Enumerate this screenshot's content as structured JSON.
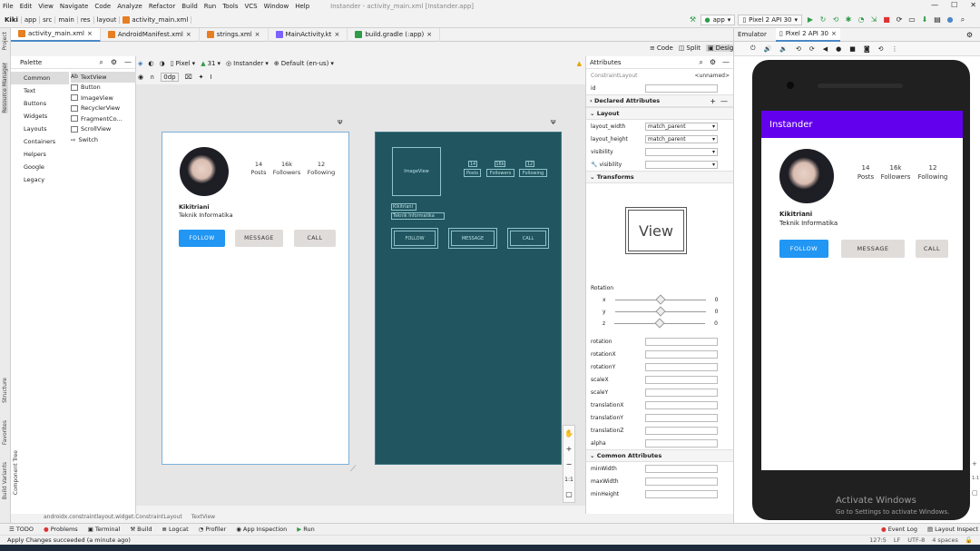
{
  "menubar": {
    "items": [
      "File",
      "Edit",
      "View",
      "Navigate",
      "Code",
      "Analyze",
      "Refactor",
      "Build",
      "Run",
      "Tools",
      "VCS",
      "Window",
      "Help"
    ],
    "title": "Instander - activity_main.xml [Instander.app]"
  },
  "navbar": {
    "crumbs": [
      "Kiki",
      "app",
      "src",
      "main",
      "res",
      "layout"
    ],
    "file": "activity_main.xml",
    "run_config": "app",
    "device": "Pixel 2 API 30"
  },
  "tabs": [
    "activity_main.xml",
    "AndroidManifest.xml",
    "strings.xml",
    "MainActivity.kt",
    "build.gradle (:app)"
  ],
  "tab_colors": [
    "#e67e22",
    "#e67e22",
    "#e67e22",
    "#7b61ff",
    "#2e9b48"
  ],
  "view_modes": {
    "code": "Code",
    "split": "Split",
    "design": "Design"
  },
  "left_strip": {
    "project": "Project",
    "resource_manager": "Resource Manager",
    "structure": "Structure",
    "favorites": "Favorites",
    "build_variants": "Build Variants",
    "component_tree": "Component Tree"
  },
  "palette": {
    "title": "Palette",
    "categories": [
      "Common",
      "Text",
      "Buttons",
      "Widgets",
      "Layouts",
      "Containers",
      "Helpers",
      "Google",
      "Legacy"
    ],
    "items": [
      {
        "label": "TextView",
        "icon": "Ab"
      },
      {
        "label": "Button",
        "icon": ""
      },
      {
        "label": "ImageView",
        "icon": ""
      },
      {
        "label": "RecyclerView",
        "icon": ""
      },
      {
        "label": "FragmentCo...",
        "icon": ""
      },
      {
        "label": "ScrollView",
        "icon": ""
      },
      {
        "label": "Switch",
        "icon": ""
      }
    ]
  },
  "design_toolbar": {
    "device": "Pixel",
    "api": "31",
    "theme": "Instander",
    "locale": "Default (en-us)",
    "margin": "0dp"
  },
  "preview": {
    "posts_count": "14",
    "posts_label": "Posts",
    "followers_count": "16k",
    "followers_label": "Followers",
    "following_count": "12",
    "following_label": "Following",
    "name": "Kikitriani",
    "bio": "Teknik Informatika",
    "follow": "FOLLOW",
    "message": "MESSAGE",
    "call": "CALL"
  },
  "blueprint": {
    "image": "ImageView",
    "posts": "Posts",
    "followers": "Followers",
    "following": "Following",
    "name": "Kikitriani",
    "bio": "Teknik Informatika",
    "follow": "FOLLOW",
    "message": "MESSAGE",
    "call": "CALL",
    "n1": "14",
    "n2": "16k",
    "n3": "12"
  },
  "zoom": {
    "plus": "+",
    "minus": "−",
    "ratio": "1:1"
  },
  "breadcrumb_bottom": {
    "parent": "androidx.constraintlayout.widget.ConstraintLayout",
    "child": "TextView"
  },
  "attributes": {
    "title": "Attributes",
    "class": "ConstraintLayout",
    "class_tag": "<unnamed>",
    "id_label": "id",
    "declared": "Declared Attributes",
    "layout": "Layout",
    "layout_width_label": "layout_width",
    "layout_width": "match_parent",
    "layout_height_label": "layout_height",
    "layout_height": "match_parent",
    "visibility_label": "visibility",
    "visibility2_label": "visibility",
    "transforms": "Transforms",
    "view_label": "View",
    "rotation_title": "Rotation",
    "axes": [
      "x",
      "y",
      "z"
    ],
    "axis_value": "0",
    "fields": [
      "rotation",
      "rotationX",
      "rotationY",
      "scaleX",
      "scaleY",
      "translationX",
      "translationY",
      "translationZ",
      "alpha"
    ],
    "common": "Common Attributes",
    "common_fields": [
      "minWidth",
      "maxWidth",
      "minHeight"
    ]
  },
  "emulator": {
    "tab1": "Emulator",
    "tab2": "Pixel 2 API 30",
    "app_title": "Instander",
    "appbar_color": "#6200ee",
    "follow_color": "#2196f3"
  },
  "bottom_tabs": [
    "TODO",
    "Problems",
    "Terminal",
    "Build",
    "Logcat",
    "Profiler",
    "App Inspection",
    "Run"
  ],
  "bottom_right": {
    "event_log": "Event Log",
    "layout_inspector": "Layout Inspect"
  },
  "status": {
    "message": "Apply Changes succeeded (a minute ago)",
    "position": "127:5",
    "line_sep": "LF",
    "encoding": "UTF-8",
    "indent": "4 spaces"
  },
  "watermark": {
    "title": "Activate Windows",
    "subtitle": "Go to Settings to activate Windows."
  }
}
